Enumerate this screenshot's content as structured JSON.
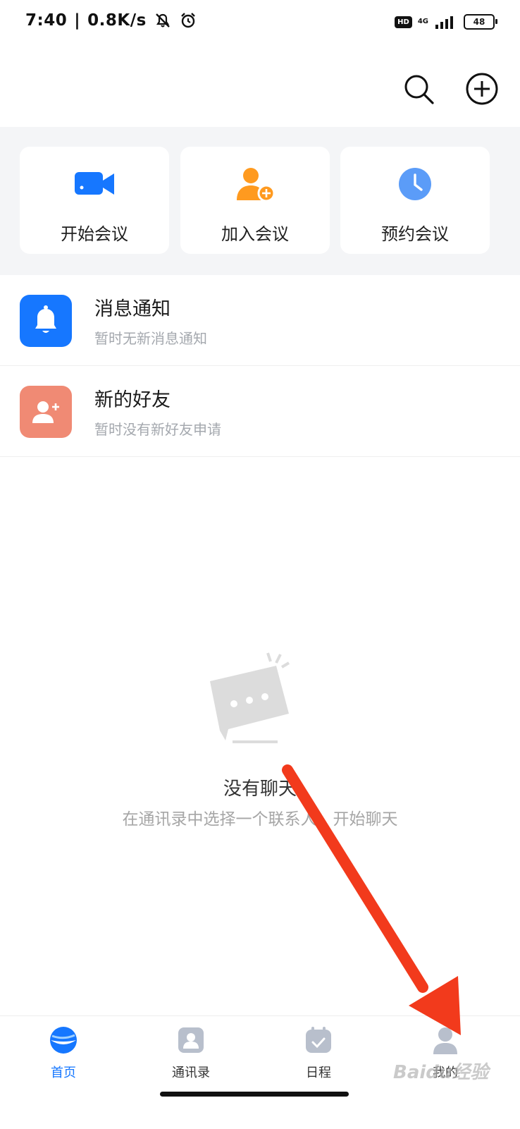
{
  "status_bar": {
    "time": "7:40",
    "speed": "0.8K/s",
    "hd": "HD",
    "network": "4G",
    "battery": "48"
  },
  "quick_actions": [
    {
      "label": "开始会议",
      "icon": "video-camera-icon",
      "color": "#1677ff"
    },
    {
      "label": "加入会议",
      "icon": "add-person-icon",
      "color": "#ff9a1f"
    },
    {
      "label": "预约会议",
      "icon": "clock-icon",
      "color": "#5b9cf8"
    }
  ],
  "list": [
    {
      "title": "消息通知",
      "subtitle": "暂时无新消息通知",
      "icon": "bell-icon",
      "color": "#1677ff"
    },
    {
      "title": "新的好友",
      "subtitle": "暂时没有新好友申请",
      "icon": "add-friend-icon",
      "color": "#f08a74"
    }
  ],
  "empty": {
    "title": "没有聊天",
    "subtitle": "在通讯录中选择一个联系人，开始聊天"
  },
  "tabs": [
    {
      "label": "首页",
      "icon": "home-logo-icon",
      "active": true
    },
    {
      "label": "通讯录",
      "icon": "contacts-icon",
      "active": false
    },
    {
      "label": "日程",
      "icon": "calendar-icon",
      "active": false
    },
    {
      "label": "我的",
      "icon": "profile-icon",
      "active": false
    }
  ],
  "watermark": "Baidu经验",
  "colors": {
    "accent": "#1677ff",
    "arrow": "#f23a1c"
  }
}
